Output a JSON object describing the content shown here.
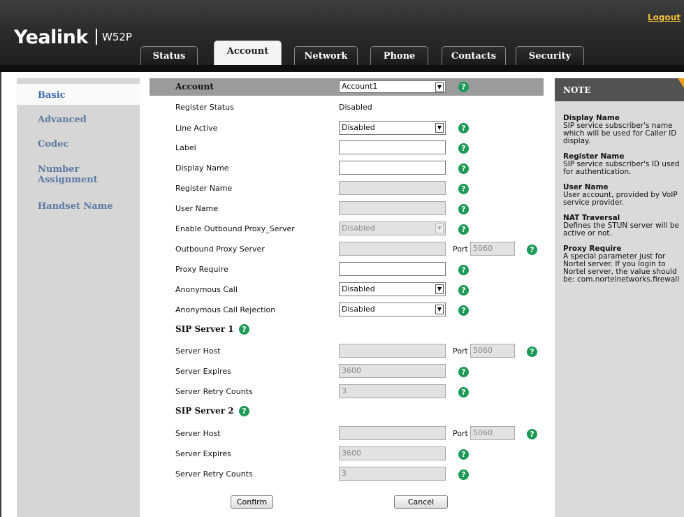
{
  "header": {
    "brand": "Yealink",
    "model": "W52P",
    "logout": "Logout",
    "tabs": [
      "Status",
      "Account",
      "Network",
      "Phone",
      "Contacts",
      "Security"
    ],
    "active_tab": "Account"
  },
  "sidebar": {
    "items": [
      "Basic",
      "Advanced",
      "Codec",
      "Number Assignment",
      "Handset Name"
    ],
    "selected": "Basic"
  },
  "form": {
    "account": {
      "label": "Account",
      "value": "Account1"
    },
    "register_status": {
      "label": "Register Status",
      "value": "Disabled"
    },
    "line_active": {
      "label": "Line Active",
      "value": "Disabled"
    },
    "label_field": {
      "label": "Label",
      "value": ""
    },
    "display_name": {
      "label": "Display Name",
      "value": ""
    },
    "register_name": {
      "label": "Register Name",
      "value": ""
    },
    "user_name": {
      "label": "User Name",
      "value": ""
    },
    "outbound_proxy_enable": {
      "label": "Enable Outbound Proxy_Server",
      "value": "Disabled"
    },
    "outbound_proxy_server": {
      "label": "Outbound Proxy Server",
      "value": "",
      "port_label": "Port",
      "port": "5060"
    },
    "proxy_require": {
      "label": "Proxy Require",
      "value": ""
    },
    "anonymous_call": {
      "label": "Anonymous Call",
      "value": "Disabled"
    },
    "anonymous_call_rejection": {
      "label": "Anonymous Call Rejection",
      "value": "Disabled"
    },
    "sip_server_1": {
      "title": "SIP Server 1",
      "server_host": {
        "label": "Server Host",
        "value": "",
        "port_label": "Port",
        "port": "5060"
      },
      "server_expires": {
        "label": "Server Expires",
        "value": "3600"
      },
      "server_retry_counts": {
        "label": "Server Retry Counts",
        "value": "3"
      }
    },
    "sip_server_2": {
      "title": "SIP Server 2",
      "server_host": {
        "label": "Server Host",
        "value": "",
        "port_label": "Port",
        "port": "5060"
      },
      "server_expires": {
        "label": "Server Expires",
        "value": "3600"
      },
      "server_retry_counts": {
        "label": "Server Retry Counts",
        "value": "3"
      }
    },
    "help_glyph": "?",
    "dropdown_glyph": "▼",
    "confirm": "Confirm",
    "cancel": "Cancel"
  },
  "note": {
    "title": "NOTE",
    "entries": [
      {
        "term": "Display Name",
        "text": "SIP service subscriber's name which will be used for Caller ID display."
      },
      {
        "term": "Register Name",
        "text": "SIP service subscriber's ID used for authentication."
      },
      {
        "term": "User Name",
        "text": "User account, provided by VoIP service provider."
      },
      {
        "term": "NAT Traversal",
        "text": "Defines the STUN server will be active or not."
      },
      {
        "term": "Proxy Require",
        "text": "A special parameter just for Nortel server. If you login to Nortel server, the value should be: com.nortelnetworks.firewall"
      }
    ]
  },
  "colors": {
    "header_bg": "#2c2c2c",
    "logout": "#f2c23a",
    "sidebar_link": "#5d7aa2",
    "help_icon": "#1c9a56",
    "note_flag": "#f39b1b"
  }
}
